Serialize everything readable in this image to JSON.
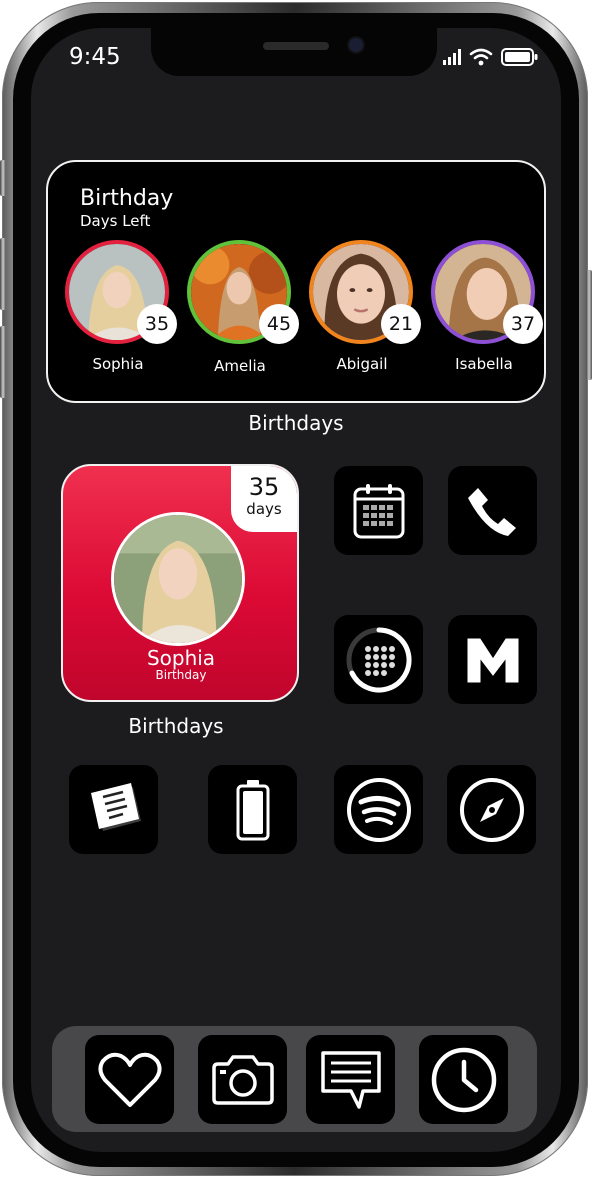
{
  "status_bar": {
    "time": "9:45"
  },
  "birthday_widget": {
    "title": "Birthday",
    "subtitle": "Days Left",
    "people": [
      {
        "name": "Sophia",
        "days": "35",
        "ring_color": "#e3213f"
      },
      {
        "name": "Amelia",
        "days": "45",
        "ring_color": "#5fc23a"
      },
      {
        "name": "Abigail",
        "days": "21",
        "ring_color": "#f2841e"
      },
      {
        "name": "Isabella",
        "days": "37",
        "ring_color": "#8c4fd6"
      }
    ],
    "caption": "Birthdays"
  },
  "small_widget": {
    "days_count": "35",
    "days_label": "days",
    "name": "Sophia",
    "subtitle": "Birthday",
    "caption": "Birthdays"
  },
  "apps": [
    {
      "name": "calendar-icon"
    },
    {
      "name": "phone-icon"
    },
    {
      "name": "activity-grid-icon"
    },
    {
      "name": "gmail-m-icon"
    },
    {
      "name": "notes-icon"
    },
    {
      "name": "battery-icon"
    },
    {
      "name": "spotify-icon"
    },
    {
      "name": "compass-icon"
    }
  ],
  "dock": [
    {
      "name": "health-heart-icon"
    },
    {
      "name": "camera-icon"
    },
    {
      "name": "messages-icon"
    },
    {
      "name": "clock-icon"
    }
  ],
  "colors": {
    "widget_red": "#dc0a35",
    "screen_bg": "#1c1c1e",
    "dock_bg": "#48484a"
  }
}
